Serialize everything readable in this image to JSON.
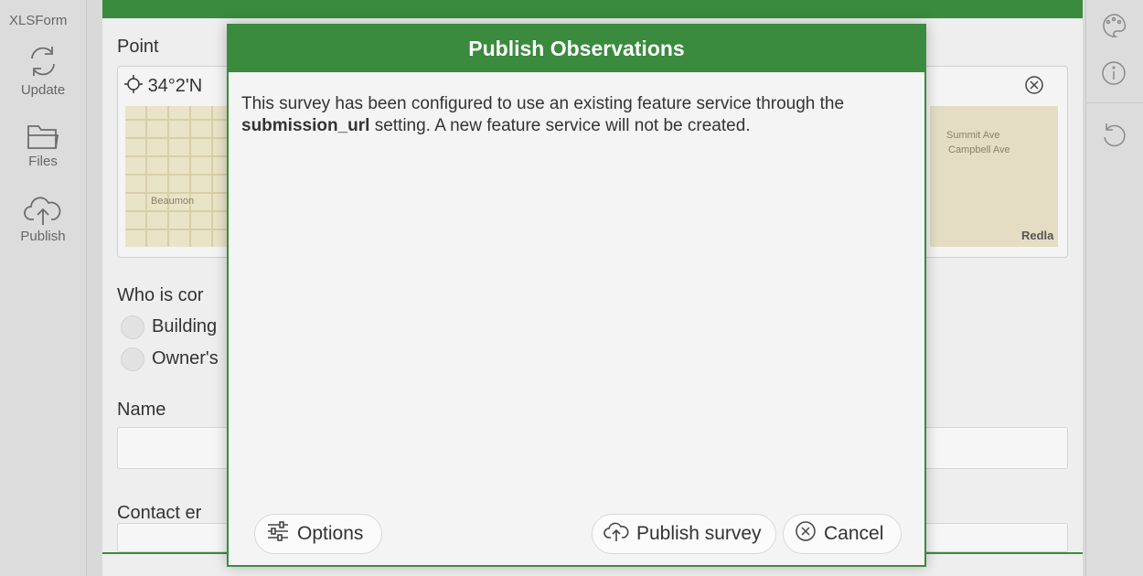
{
  "left_toolbar": {
    "brand": "XLSForm",
    "items": [
      {
        "label": "Update",
        "icon": "refresh-icon"
      },
      {
        "label": "Files",
        "icon": "folder-icon"
      },
      {
        "label": "Publish",
        "icon": "cloud-upload-icon"
      }
    ]
  },
  "right_toolbar": {
    "icons": [
      "palette-icon",
      "info-icon",
      "undo-icon"
    ]
  },
  "form": {
    "point_label": "Point",
    "coords": "34°2'N",
    "map_labels": {
      "left_street": "Beaumon",
      "right_streets": "Summit Ave",
      "right_streets_2": "Campbell Ave",
      "city": "Redla"
    },
    "who_label": "Who is cor",
    "options": [
      "Building",
      "Owner's"
    ],
    "name_label": "Name",
    "contact_label": "Contact er"
  },
  "modal": {
    "title": "Publish Observations",
    "message_prefix": "This survey has been configured to use an existing feature service through the ",
    "message_bold": "submission_url",
    "message_suffix": " setting. A new feature service will not be created.",
    "options_label": "Options",
    "publish_label": "Publish survey",
    "cancel_label": "Cancel"
  },
  "colors": {
    "accent_green": "#3a8b3e",
    "modal_bg": "#f4f4f4",
    "toolbar_bg": "#dcdcdc"
  }
}
